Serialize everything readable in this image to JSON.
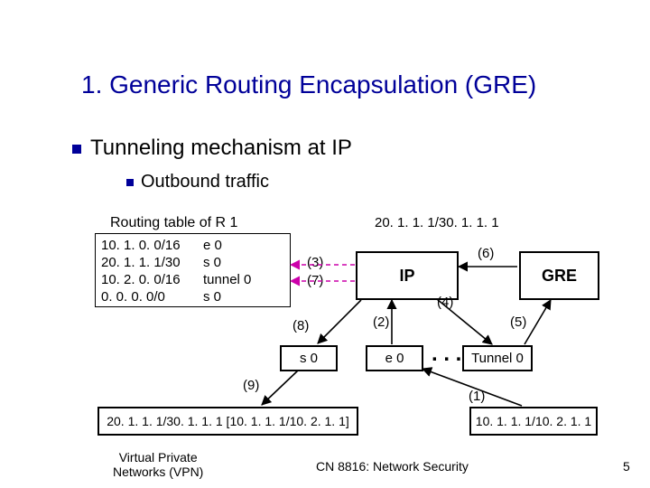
{
  "title": "1. Generic Routing Encapsulation (GRE)",
  "bullets": {
    "b1": "Tunneling mechanism at IP",
    "b2": "Outbound traffic"
  },
  "routing_table": {
    "title": "Routing table of R 1",
    "col_prefix": "10. 1. 0. 0/16\n20. 1. 1. 1/30\n10. 2. 0. 0/16\n0. 0. 0. 0/0",
    "col_iface": "e 0\ns 0\ntunnel 0\ns 0"
  },
  "topright_label": "20. 1. 1. 1/30. 1. 1. 1",
  "boxes": {
    "ip": "IP",
    "gre": "GRE",
    "s0": "s 0",
    "e0": "e 0",
    "tunnel0": "Tunnel 0",
    "dots": ". . ."
  },
  "payloads": {
    "left": "20. 1. 1. 1/30. 1. 1. 1 [10. 1. 1. 1/10. 2. 1. 1]",
    "right": "10. 1. 1. 1/10. 2. 1. 1"
  },
  "steps": {
    "s1": "(1)",
    "s2": "(2)",
    "s3": "(3)",
    "s4": "(4)",
    "s5": "(5)",
    "s6": "(6)",
    "s7": "(7)",
    "s8": "(8)",
    "s9": "(9)"
  },
  "footer": {
    "left_l1": "Virtual Private",
    "left_l2": "Networks (VPN)",
    "center": "CN 8816: Network Security",
    "right": "5"
  }
}
